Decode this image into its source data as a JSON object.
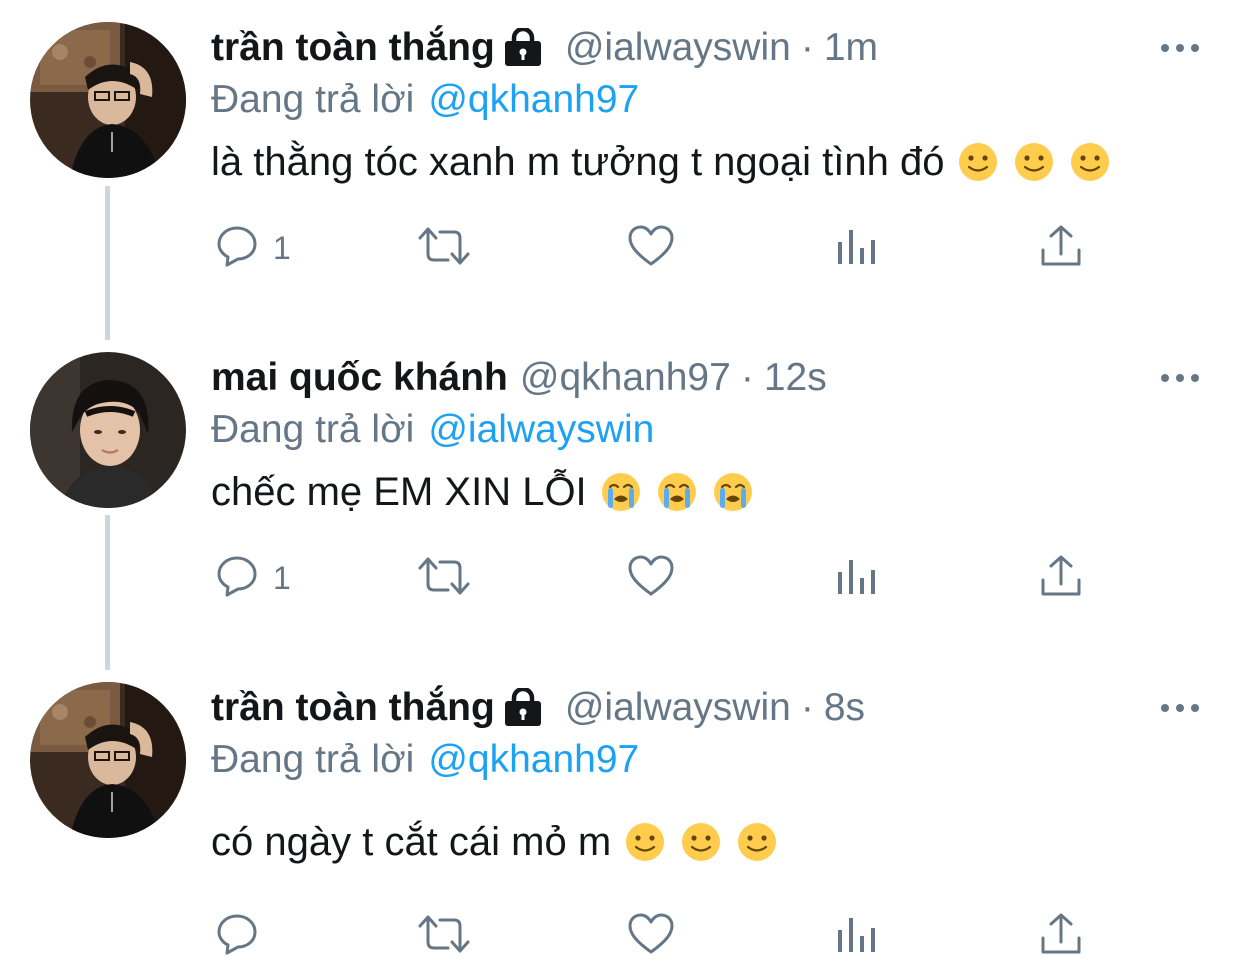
{
  "thread": [
    {
      "display_name": "trần toàn thắng",
      "protected": true,
      "handle": "@ialwayswin",
      "separator": "·",
      "time": "1m",
      "reply_prefix": "Đang trả lời",
      "reply_to": "@qkhanh97",
      "text": "là thằng tóc xanh m tưởng t ngoại tình đó",
      "emojis": [
        "slightly-smiling-face",
        "slightly-smiling-face",
        "slightly-smiling-face"
      ],
      "reply_count": "1",
      "avatar": "avatar-thang"
    },
    {
      "display_name": "mai quốc khánh",
      "protected": false,
      "handle": "@qkhanh97",
      "separator": "·",
      "time": "12s",
      "reply_prefix": "Đang trả lời",
      "reply_to": "@ialwayswin",
      "text": "chếc mẹ EM XIN LỖI",
      "emojis": [
        "loudly-crying-face",
        "loudly-crying-face",
        "loudly-crying-face"
      ],
      "reply_count": "1",
      "avatar": "avatar-khanh"
    },
    {
      "display_name": "trần toàn thắng",
      "protected": true,
      "handle": "@ialwayswin",
      "separator": "·",
      "time": "8s",
      "reply_prefix": "Đang trả lời",
      "reply_to": "@qkhanh97",
      "text": "có ngày t cắt cái mỏ m",
      "emojis": [
        "slightly-smiling-face",
        "slightly-smiling-face",
        "slightly-smiling-face"
      ],
      "reply_count": "",
      "avatar": "avatar-thang"
    }
  ],
  "colors": {
    "text_primary": "#14171a",
    "text_secondary": "#657786",
    "link": "#1da1f2",
    "thread_line": "#ccd6dd",
    "icon": "#657786"
  },
  "icons": {
    "reply": "comment-bubble-icon",
    "retweet": "retweet-arrows-icon",
    "like": "heart-icon",
    "analytics": "bar-chart-icon",
    "share": "share-upload-icon",
    "more": "more-dots-icon",
    "lock": "lock-icon"
  }
}
